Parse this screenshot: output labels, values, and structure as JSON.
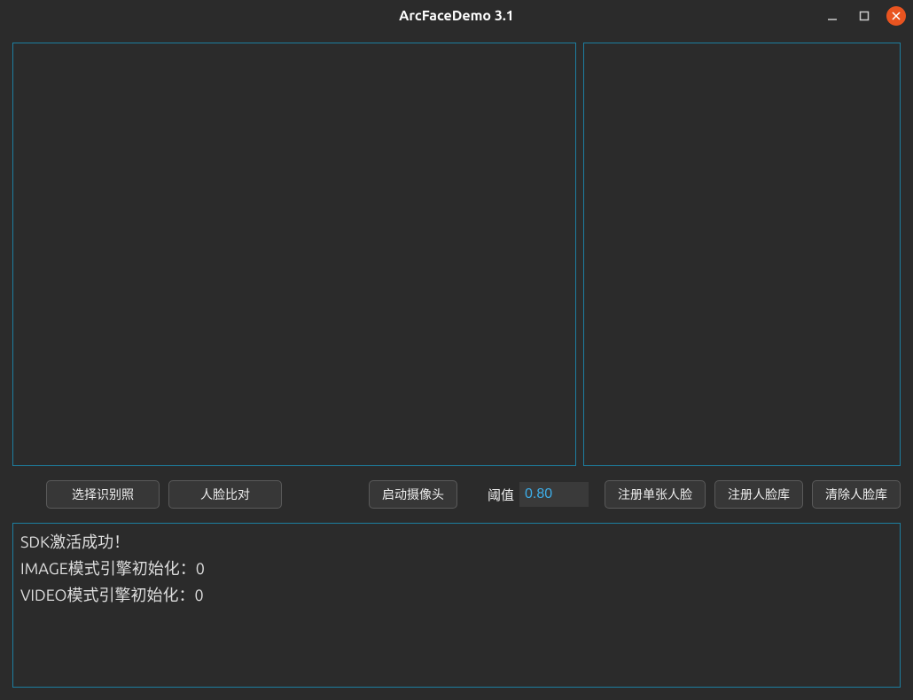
{
  "window": {
    "title": "ArcFaceDemo 3.1"
  },
  "toolbar": {
    "select_photo": "选择识别照",
    "face_compare": "人脸比对",
    "start_camera": "启动摄像头",
    "threshold_label": "阈值",
    "threshold_value": "0.80",
    "register_single": "注册单张人脸",
    "register_library": "注册人脸库",
    "clear_library": "清除人脸库"
  },
  "log": {
    "line1": "SDK激活成功！",
    "line2": "IMAGE模式引擎初始化：0",
    "line3": "VIDEO模式引擎初始化：0"
  }
}
